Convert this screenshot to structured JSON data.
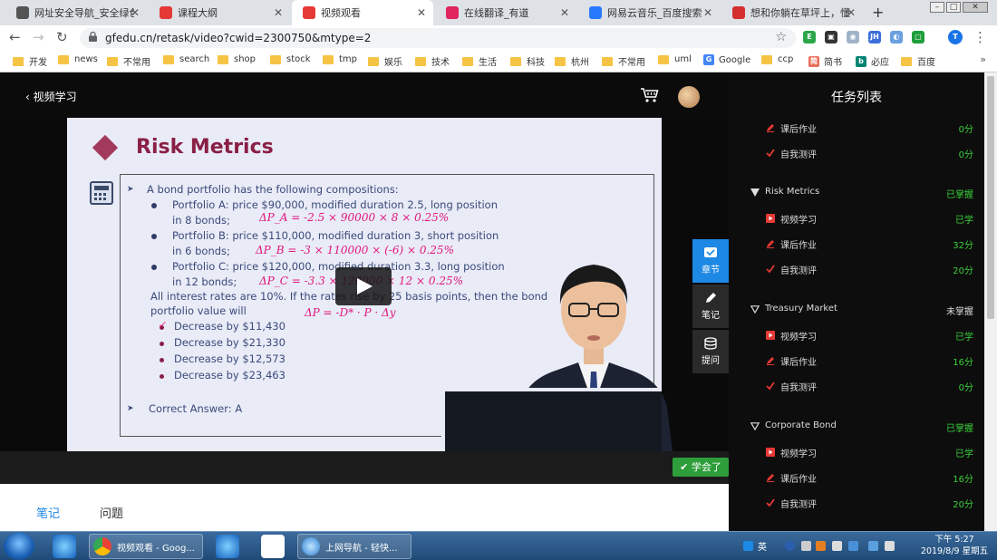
{
  "browser": {
    "tabs": [
      {
        "label": "网址安全导航_安全绿色",
        "icon": "safe-browsing-icon",
        "color": "#555555",
        "active": false
      },
      {
        "label": "课程大纲",
        "icon": "gfedu-icon",
        "color": "#e53935",
        "active": false
      },
      {
        "label": "视频观看",
        "icon": "gfedu-icon",
        "color": "#e53935",
        "active": true
      },
      {
        "label": "在线翻译_有道",
        "icon": "youdao-icon",
        "color": "#e0245e",
        "active": false
      },
      {
        "label": "网易云音乐_百度搜索",
        "icon": "baidu-paw-icon",
        "color": "#2979ff",
        "active": false
      },
      {
        "label": "想和你躺在草坪上，懂",
        "icon": "netease-music-icon",
        "color": "#d32f2f",
        "active": false
      }
    ],
    "new_tab": "+",
    "url": "gfedu.cn/retask/video?cwid=2300750&mtype=2",
    "bookmarks": [
      "开发",
      "news",
      "不常用",
      "search",
      "shop",
      "stock",
      "tmp",
      "娱乐",
      "技术",
      "生活",
      "科技",
      "杭州",
      "不常用",
      "uml"
    ],
    "bookmarks_sites": [
      {
        "label": "Google",
        "icon": "G",
        "color": "#4285f4"
      },
      {
        "label": "ccp",
        "icon": "",
        "color": "#f6c445"
      },
      {
        "label": "简书",
        "icon": "简",
        "color": "#ea6f5a"
      },
      {
        "label": "必应",
        "icon": "b",
        "color": "#008373"
      },
      {
        "label": "百度",
        "icon": "",
        "color": "#f6c445"
      }
    ],
    "bookmarks_more": "»",
    "profile_initial": "T"
  },
  "player": {
    "back_label": "视频学习",
    "slide": {
      "title": "Risk Metrics",
      "intro": "A bond portfolio has the following compositions:",
      "portfolios": [
        {
          "line1": "Portfolio A: price $90,000, modified duration 2.5, long position",
          "line2": "in 8 bonds;",
          "note": "ΔP_A = -2.5 × 90000 × 8 × 0.25%"
        },
        {
          "line1": "Portfolio B: price $110,000, modified duration 3, short position",
          "line2": "in 6 bonds;",
          "note": "ΔP_B = -3 × 110000 × (-6) × 0.25%"
        },
        {
          "line1": "Portfolio C: price $120,000, modified duration 3.3, long position",
          "line2": "in 12 bonds;",
          "note": "ΔP_C = -3.3 × 120000 × 12 × 0.25%"
        }
      ],
      "question_line1": "All interest rates are 10%. If the rates rise by 25 basis points, then the bond",
      "question_line2": "portfolio value will",
      "formula_note": "ΔP = -D* · P · Δy",
      "options": [
        "Decrease by $11,430",
        "Decrease by $21,330",
        "Decrease by $12,573",
        "Decrease by $23,463"
      ],
      "answer": "Correct Answer: A"
    },
    "tools": [
      {
        "label": "章节",
        "icon": "chapter-icon"
      },
      {
        "label": "笔记",
        "icon": "pencil-icon"
      },
      {
        "label": "提问",
        "icon": "database-icon"
      }
    ],
    "learned_button": "学会了",
    "lower_tabs": [
      "笔记",
      "问题"
    ]
  },
  "task_panel": {
    "title": "任务列表",
    "top_items": [
      {
        "label": "课后作业",
        "value": "0分",
        "icon": "pencil-check-icon"
      },
      {
        "label": "自我测评",
        "value": "0分",
        "icon": "check-icon"
      }
    ],
    "sections": [
      {
        "name": "Risk Metrics",
        "status": "已掌握",
        "status_color": "#3ad13a",
        "expanded": true,
        "items": [
          {
            "label": "视频学习",
            "value": "已学",
            "icon": "play-icon"
          },
          {
            "label": "课后作业",
            "value": "32分",
            "icon": "pencil-check-icon"
          },
          {
            "label": "自我测评",
            "value": "20分",
            "icon": "check-icon"
          }
        ]
      },
      {
        "name": "Treasury Market",
        "status": "未掌握",
        "status_color": "#dddddd",
        "expanded": false,
        "items": [
          {
            "label": "视频学习",
            "value": "已学",
            "icon": "play-icon"
          },
          {
            "label": "课后作业",
            "value": "16分",
            "icon": "pencil-check-icon"
          },
          {
            "label": "自我测评",
            "value": "0分",
            "icon": "check-icon"
          }
        ]
      },
      {
        "name": "Corporate Bond",
        "status": "已掌握",
        "status_color": "#3ad13a",
        "expanded": false,
        "items": [
          {
            "label": "视频学习",
            "value": "已学",
            "icon": "play-icon"
          },
          {
            "label": "课后作业",
            "value": "16分",
            "icon": "pencil-check-icon"
          },
          {
            "label": "自我测评",
            "value": "20分",
            "icon": "check-icon"
          }
        ]
      }
    ]
  },
  "taskbar": {
    "apps": [
      {
        "label": "视频观看 - Goog...",
        "icon": "chrome-icon"
      },
      {
        "label": "上网导航 - 轻快...",
        "icon": "browser-icon"
      }
    ],
    "ime": "英",
    "time": "下午 5:27",
    "date": "2019/8/9 星期五"
  }
}
